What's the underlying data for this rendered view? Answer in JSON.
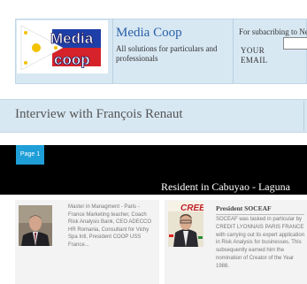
{
  "header": {
    "brand_name": "Media Coop",
    "tagline": "All solutions for particulars and professionals",
    "logo_text_top": "Media",
    "logo_text_bottom": "coop",
    "subscribe_text": "For subacribing to Ne",
    "email_label": "YOUR EMAIL",
    "email_value": ""
  },
  "page": {
    "title": "Interview with François Renaut",
    "tab_label": "Page 1",
    "banner": "Resident in Cabuyao - Laguna"
  },
  "card1": {
    "text": "Master in Managment - Paris - France Marketing teacher, Coach Risk Analysis Bank, CEO ADECCO HR Romania, Consultant for Vichy Spa Intl, President COOP USS France..."
  },
  "card2": {
    "heading": "President SOCEAF",
    "text": "SOCEAF was tasked in particular by CREDIT LYONNAIS PARIS FRANCE with carrying out its expert application in Risk Analysis for businesses. This subsequently earned him the nomination of Creator of the Year 1988.",
    "magazine_title": "CREEF"
  },
  "colors": {
    "header_bg": "#d8e8f3",
    "brand_blue": "#2a60a8",
    "tab_blue": "#1f9fd8",
    "strip": "#000000"
  }
}
